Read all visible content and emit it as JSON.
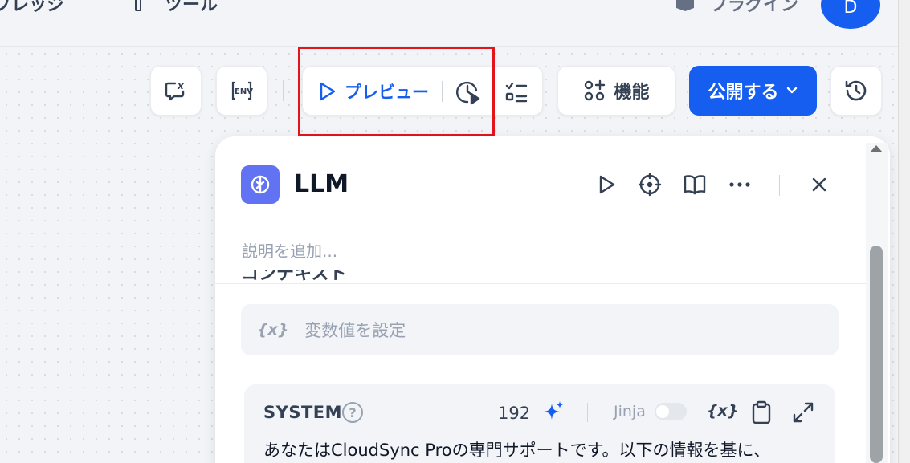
{
  "topnav": {
    "item1": "ブレッジ",
    "item2": "ツール",
    "item3": "プラグイン",
    "avatar_initial": "D"
  },
  "toolbar": {
    "preview_label": "プレビュー",
    "features_label": "機能",
    "publish_label": "公開する"
  },
  "node": {
    "title": "LLM",
    "description_placeholder": "説明を追加...",
    "context_label": "コンテキスト",
    "variable_placeholder": "変数値を設定",
    "variable_brace": "{x}"
  },
  "system_prompt": {
    "label": "SYSTEM",
    "help": "?",
    "char_count": "192",
    "jinja_label": "Jinja",
    "brace": "{x}",
    "text": "あなたはCloudSync Proの専門サポートです。以下の情報を基に、"
  },
  "colors": {
    "accent": "#155eef",
    "llm_icon_bg": "#6172f3",
    "highlight": "#e4141b"
  },
  "icons": {
    "toolbar": [
      "variable-inspect-icon",
      "env-icon",
      "play-icon",
      "run-history-icon",
      "checklist-icon",
      "features-icon",
      "chevron-down-icon",
      "history-icon"
    ],
    "panel": [
      "play-icon",
      "target-icon",
      "book-icon",
      "more-icon",
      "close-icon"
    ],
    "system": [
      "help-icon",
      "sparkle-icon",
      "clipboard-icon",
      "expand-icon"
    ]
  }
}
